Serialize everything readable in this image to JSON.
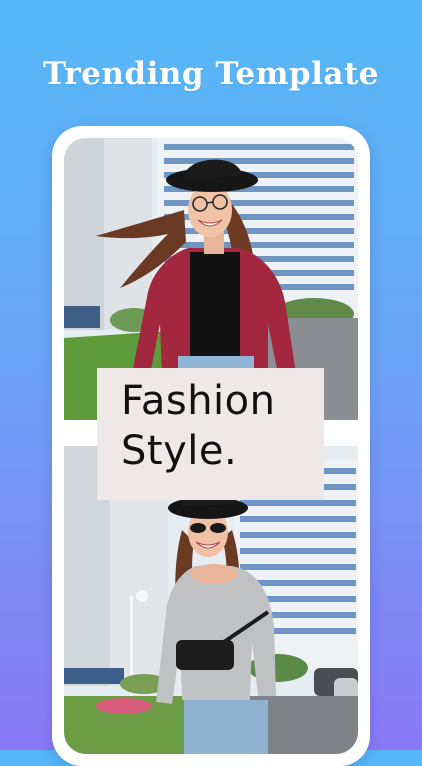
{
  "header": {
    "title": "Trending Template"
  },
  "template": {
    "text_line_1": "Fashion",
    "text_line_2": "Style."
  },
  "colors": {
    "background_top": "#55b8f8",
    "background_bottom": "#8a78f4",
    "card_background": "#efe8e8"
  }
}
